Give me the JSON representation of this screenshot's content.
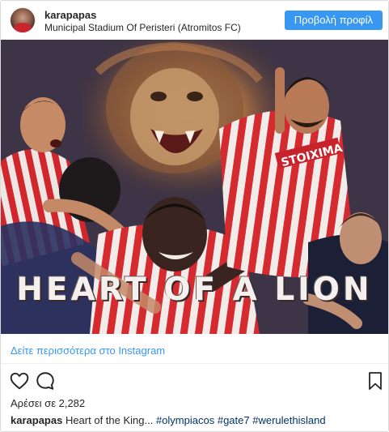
{
  "header": {
    "username": "karapapas",
    "location": "Municipal Stadium Of Peristeri (Atromitos FC)",
    "profile_button": "Προβολή προφίλ"
  },
  "media": {
    "banner_text": "HEART OF A LION",
    "jersey_text": "STOIXIMA"
  },
  "see_more": {
    "label": "Δείτε περισσότερα στο Instagram"
  },
  "actions": {
    "like_icon": "heart-icon",
    "comment_icon": "comment-icon",
    "save_icon": "bookmark-icon"
  },
  "likes": {
    "text": "Αρέσει σε 2,282"
  },
  "caption": {
    "user": "karapapas",
    "text": " Heart of the King... ",
    "tags": [
      "#olympiacos",
      "#gate7",
      "#werulethisland"
    ]
  }
}
